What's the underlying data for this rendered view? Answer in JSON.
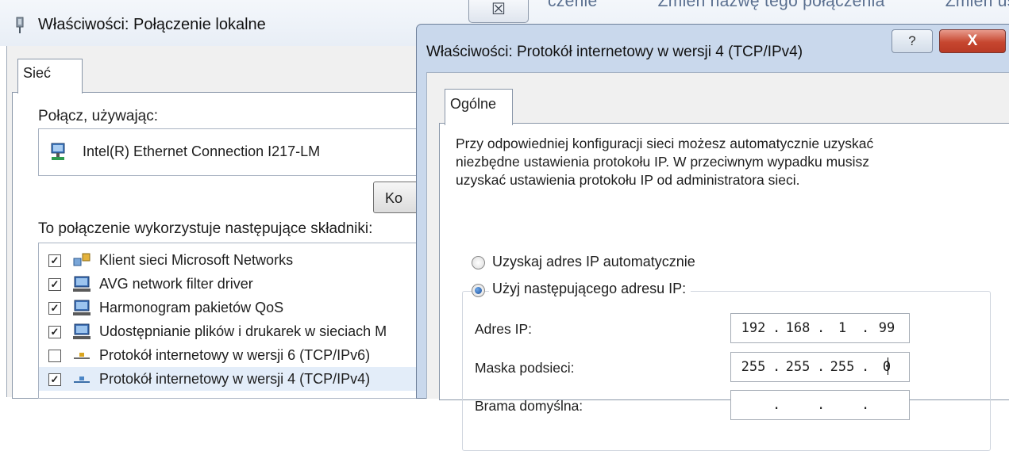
{
  "background_window": {
    "title": "Właściwości: Połączenie lokalne",
    "close_glyph": "☒",
    "toolbar_items": [
      "czenie",
      "Zmień nazwę tego połączenia",
      "Zmień ustaw"
    ],
    "tab_label": "Sieć",
    "connect_using_label": "Połącz, używając:",
    "adapter_name": "Intel(R) Ethernet Connection I217-LM",
    "configure_button": "Ko",
    "components_label": "To połączenie wykorzystuje następujące składniki:",
    "components": [
      {
        "label": "Klient sieci Microsoft Networks",
        "checked": true,
        "icon": "network-client-icon"
      },
      {
        "label": "AVG network filter driver",
        "checked": true,
        "icon": "network-service-icon"
      },
      {
        "label": "Harmonogram pakietów QoS",
        "checked": true,
        "icon": "network-service-icon"
      },
      {
        "label": "Udostępnianie plików i drukarek w sieciach M",
        "checked": true,
        "icon": "network-service-icon"
      },
      {
        "label": "Protokół internetowy w wersji 6 (TCP/IPv6)",
        "checked": false,
        "icon": "protocol-icon"
      },
      {
        "label": "Protokół internetowy w wersji 4 (TCP/IPv4)",
        "checked": true,
        "icon": "protocol-icon",
        "selected": true
      }
    ]
  },
  "dialog": {
    "title": "Właściwości: Protokół internetowy w wersji 4 (TCP/IPv4)",
    "help_glyph": "?",
    "close_glyph": "X",
    "tab_label": "Ogólne",
    "description_lines": [
      "Przy odpowiedniej konfiguracji sieci możesz automatycznie uzyskać",
      "niezbędne ustawienia protokołu IP. W przeciwnym wypadku musisz",
      "uzyskać ustawienia protokołu IP od administratora sieci."
    ],
    "radio_auto_label": "Uzyskaj adres IP automatycznie",
    "radio_static_label": "Użyj następującego adresu IP:",
    "radio_selected": "static",
    "fields": [
      {
        "label": "Adres IP:",
        "octets": [
          "192",
          "168",
          "1",
          "99"
        ]
      },
      {
        "label": "Maska podsieci:",
        "octets": [
          "255",
          "255",
          "255",
          "0"
        ]
      },
      {
        "label": "Brama domyślna:",
        "octets": [
          "",
          "",
          "",
          ""
        ]
      }
    ]
  },
  "colors": {
    "title_bar": "#c9d8ec",
    "close_button": "#c6462f",
    "selection": "#e3edf9"
  }
}
